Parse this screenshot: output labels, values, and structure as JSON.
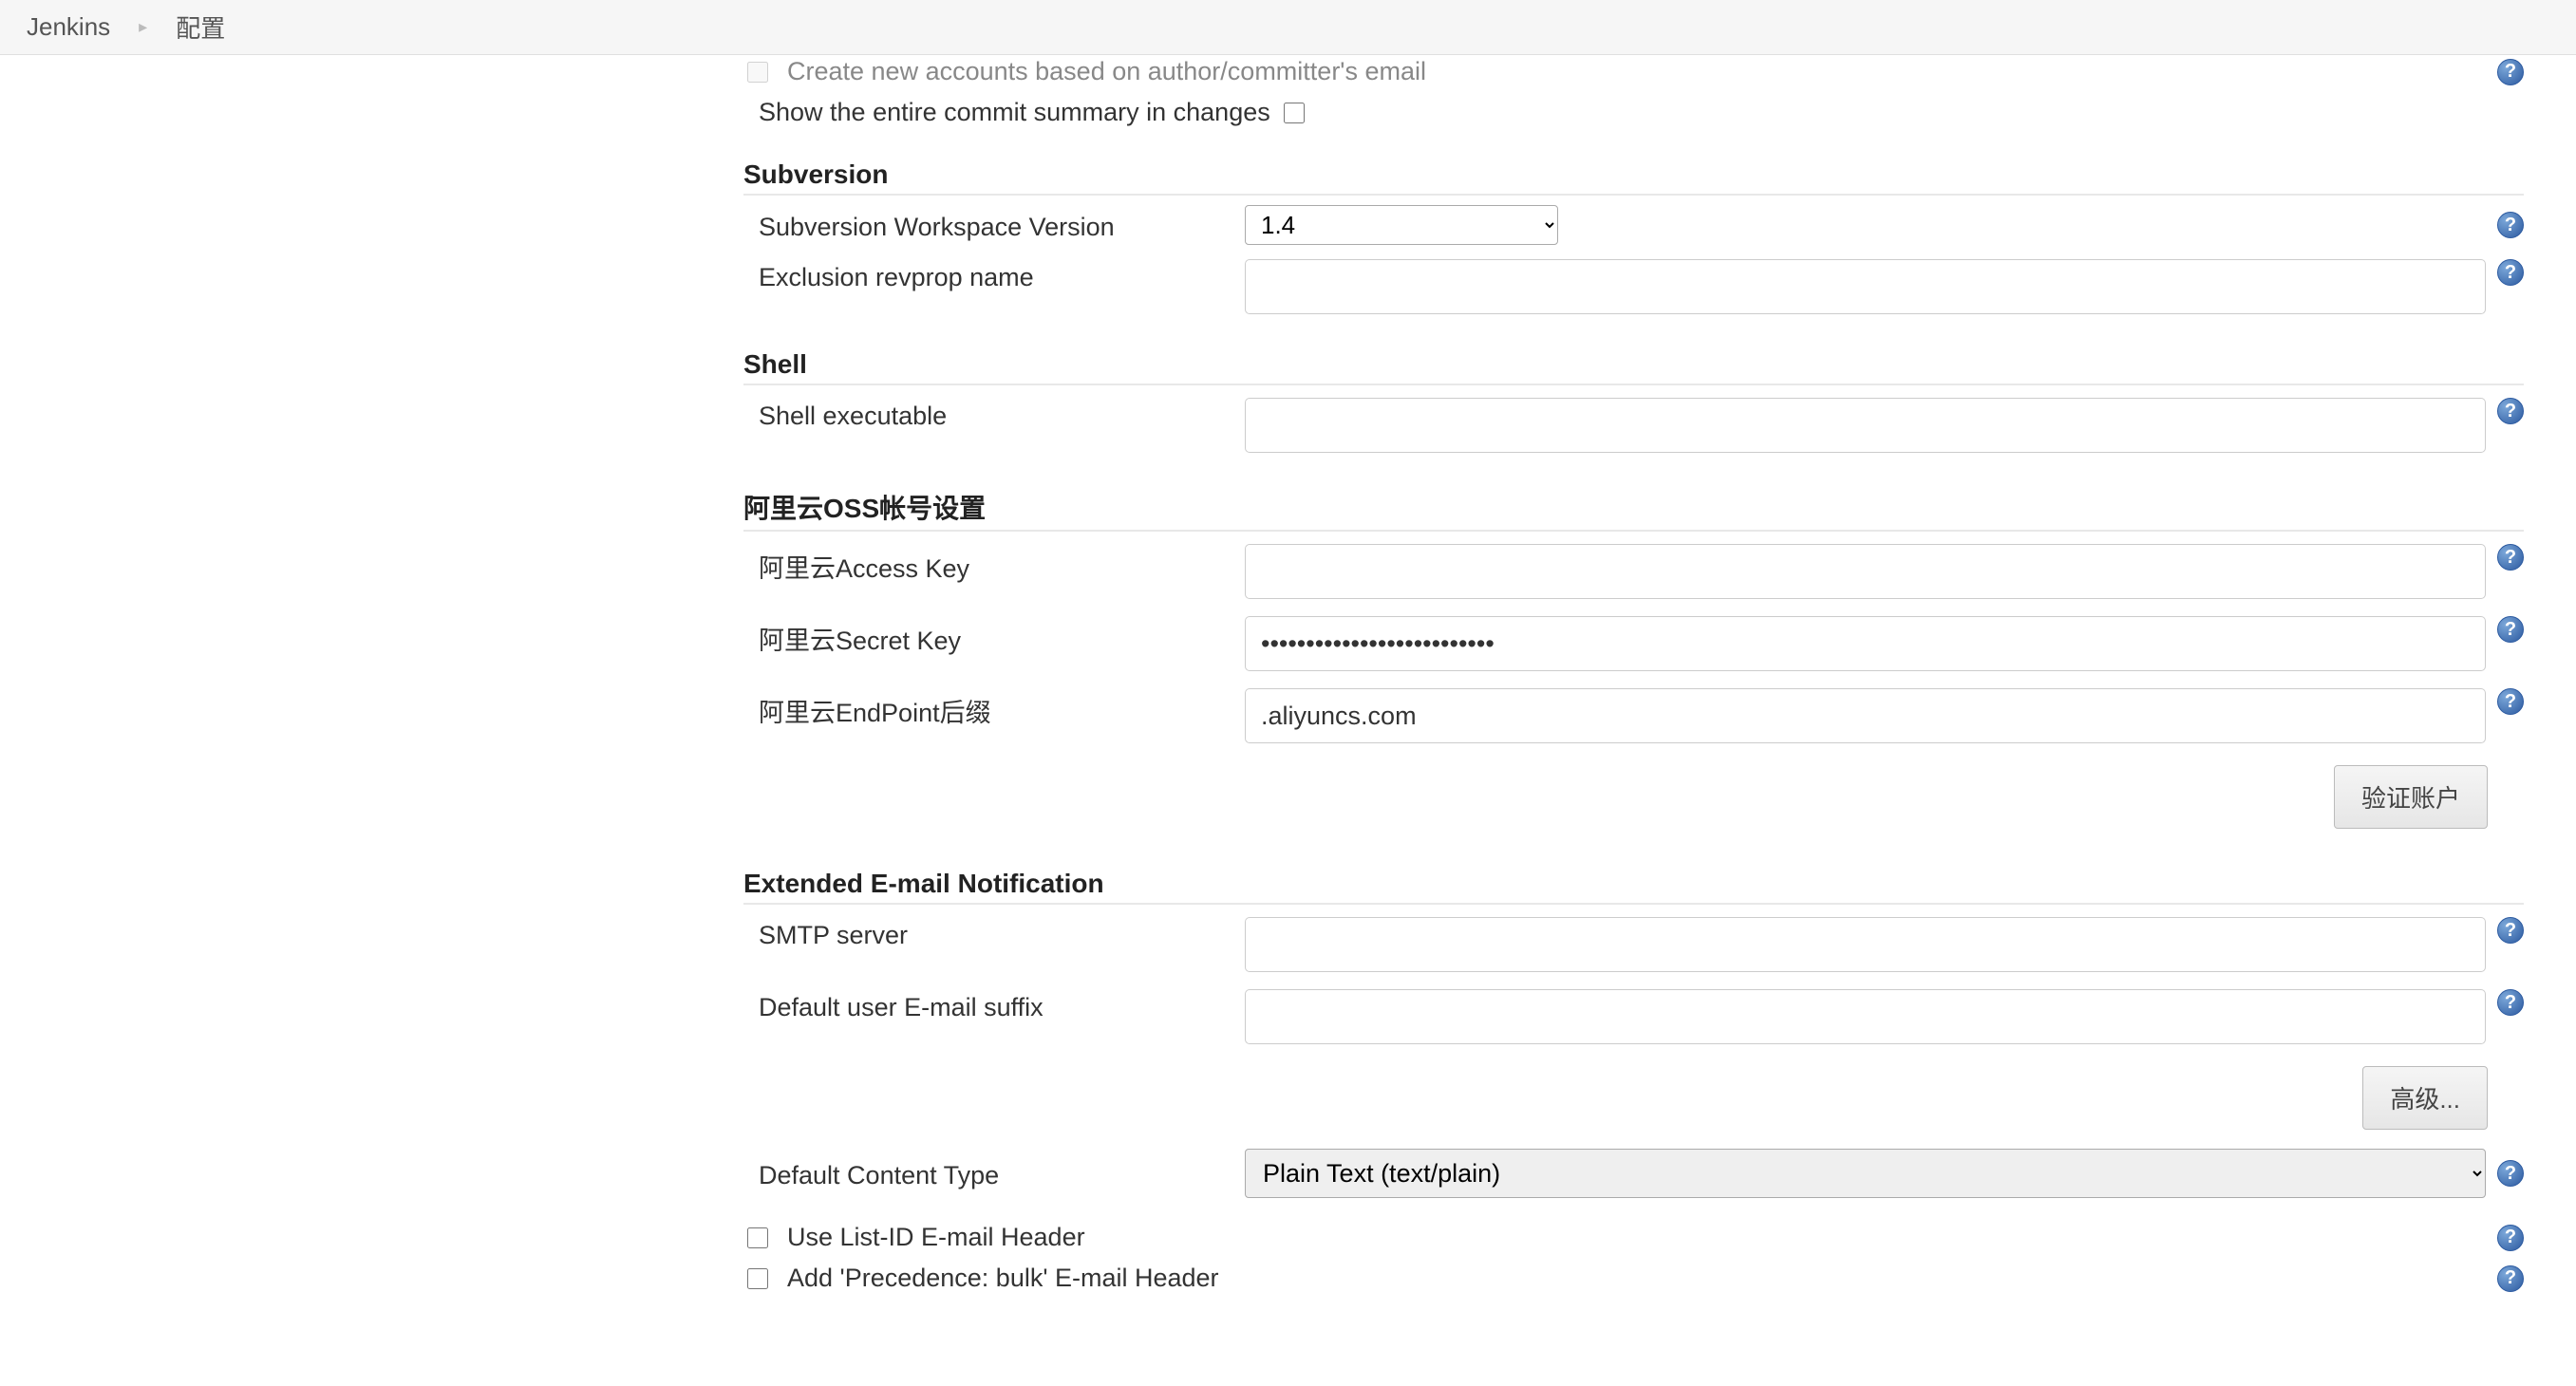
{
  "breadcrumb": {
    "root": "Jenkins",
    "page": "配置"
  },
  "git": {
    "create_accounts_label": "Create new accounts based on author/committer's email",
    "show_commit_summary_label": "Show the entire commit summary in changes"
  },
  "subversion": {
    "title": "Subversion",
    "workspace_version_label": "Subversion Workspace Version",
    "workspace_version_value": "1.4",
    "exclusion_label": "Exclusion revprop name",
    "exclusion_value": ""
  },
  "shell": {
    "title": "Shell",
    "executable_label": "Shell executable",
    "executable_value": ""
  },
  "aliyun": {
    "title": "阿里云OSS帐号设置",
    "access_key_label": "阿里云Access Key",
    "secret_key_label": "阿里云Secret Key",
    "secret_key_value": "••••••••••••••••••••••••••",
    "endpoint_label": "阿里云EndPoint后缀",
    "endpoint_value": ".aliyuncs.com",
    "verify_button": "验证账户"
  },
  "email": {
    "title": "Extended E-mail Notification",
    "smtp_label": "SMTP server",
    "smtp_value": "",
    "default_suffix_label": "Default user E-mail suffix",
    "default_suffix_value": "",
    "advanced_button": "高级...",
    "content_type_label": "Default Content Type",
    "content_type_value": "Plain Text (text/plain)",
    "use_listid_label": "Use List-ID E-mail Header",
    "add_precedence_label": "Add 'Precedence: bulk' E-mail Header"
  },
  "help_glyph": "?"
}
